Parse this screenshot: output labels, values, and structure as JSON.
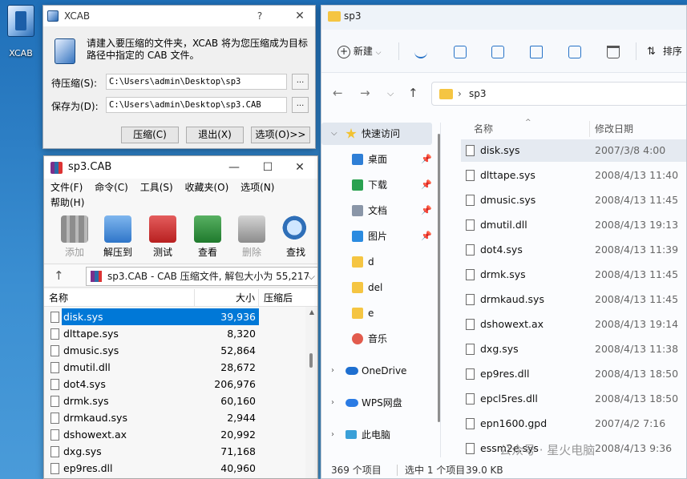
{
  "desktop": {
    "icon_label": "XCAB"
  },
  "xcab": {
    "title": "XCAB",
    "help": "?",
    "close": "✕",
    "message": "请建入要压缩的文件夹，XCAB 将为您压缩成为目标路径中指定的 CAB 文件。",
    "source_label": "待压缩(S):",
    "source_value": "C:\\Users\\admin\\Desktop\\sp3",
    "target_label": "保存为(D):",
    "target_value": "C:\\Users\\admin\\Desktop\\sp3.CAB",
    "browse": "...",
    "btn_compress": "压缩(C)",
    "btn_exit": "退出(X)",
    "btn_options": "选项(O)>>"
  },
  "rar": {
    "title": "sp3.CAB",
    "minimize": "—",
    "maximize": "☐",
    "close": "✕",
    "menu": [
      "文件(F)",
      "命令(C)",
      "工具(S)",
      "收藏夹(O)",
      "选项(N)",
      "帮助(H)"
    ],
    "tools": [
      "添加",
      "解压到",
      "测试",
      "查看",
      "删除",
      "查找"
    ],
    "up": "↑",
    "path": "sp3.CAB - CAB 压缩文件, 解包大小为 55,217",
    "dropdown": "⌵",
    "col_name": "名称",
    "col_size": "大小",
    "col_compressed": "压缩后",
    "rows": [
      {
        "name": "disk.sys",
        "size": "39,936"
      },
      {
        "name": "dlttape.sys",
        "size": "8,320"
      },
      {
        "name": "dmusic.sys",
        "size": "52,864"
      },
      {
        "name": "dmutil.dll",
        "size": "28,672"
      },
      {
        "name": "dot4.sys",
        "size": "206,976"
      },
      {
        "name": "drmk.sys",
        "size": "60,160"
      },
      {
        "name": "drmkaud.sys",
        "size": "2,944"
      },
      {
        "name": "dshowext.ax",
        "size": "20,992"
      },
      {
        "name": "dxg.sys",
        "size": "71,168"
      },
      {
        "name": "ep9res.dll",
        "size": "40,960"
      }
    ]
  },
  "explorer": {
    "tab_title": "sp3",
    "new_label": "新建",
    "new_caret": "⌵",
    "sort_label": "排序",
    "back": "←",
    "forward": "→",
    "down": "⌵",
    "up": "↑",
    "addr_sep": "›",
    "addr_path": "sp3",
    "nav": [
      {
        "label": "快速访问",
        "chev": "⌵",
        "pin": ""
      },
      {
        "label": "桌面",
        "chev": "",
        "pin": "📌"
      },
      {
        "label": "下载",
        "chev": "",
        "pin": "📌"
      },
      {
        "label": "文档",
        "chev": "",
        "pin": "📌"
      },
      {
        "label": "图片",
        "chev": "",
        "pin": "📌"
      },
      {
        "label": "d",
        "chev": "",
        "pin": ""
      },
      {
        "label": "del",
        "chev": "",
        "pin": ""
      },
      {
        "label": "e",
        "chev": "",
        "pin": ""
      },
      {
        "label": "音乐",
        "chev": "",
        "pin": ""
      },
      {
        "label": "OneDrive",
        "chev": "›",
        "pin": ""
      },
      {
        "label": "WPS网盘",
        "chev": "›",
        "pin": ""
      },
      {
        "label": "此电脑",
        "chev": "›",
        "pin": ""
      }
    ],
    "col_name": "名称",
    "col_date": "修改日期",
    "files": [
      {
        "name": "disk.sys",
        "date": "2007/3/8 4:00"
      },
      {
        "name": "dlttape.sys",
        "date": "2008/4/13 11:40"
      },
      {
        "name": "dmusic.sys",
        "date": "2008/4/13 11:45"
      },
      {
        "name": "dmutil.dll",
        "date": "2008/4/13 19:13"
      },
      {
        "name": "dot4.sys",
        "date": "2008/4/13 11:39"
      },
      {
        "name": "drmk.sys",
        "date": "2008/4/13 11:45"
      },
      {
        "name": "drmkaud.sys",
        "date": "2008/4/13 11:45"
      },
      {
        "name": "dshowext.ax",
        "date": "2008/4/13 19:14"
      },
      {
        "name": "dxg.sys",
        "date": "2008/4/13 11:38"
      },
      {
        "name": "ep9res.dll",
        "date": "2008/4/13 18:50"
      },
      {
        "name": "epcl5res.dll",
        "date": "2008/4/13 18:50"
      },
      {
        "name": "epn1600.gpd",
        "date": "2007/4/2 7:16"
      },
      {
        "name": "essm2e.sys",
        "date": "2008/4/13 9:36"
      }
    ],
    "status_count": "369 个项目",
    "status_selected": "选中 1 个项目",
    "status_size": "39.0 KB",
    "watermark": "公众号 · 星火电脑"
  },
  "colors": {
    "selection": "#0078d7",
    "folder": "#f5c542",
    "desktop": "#2f7fc2"
  }
}
